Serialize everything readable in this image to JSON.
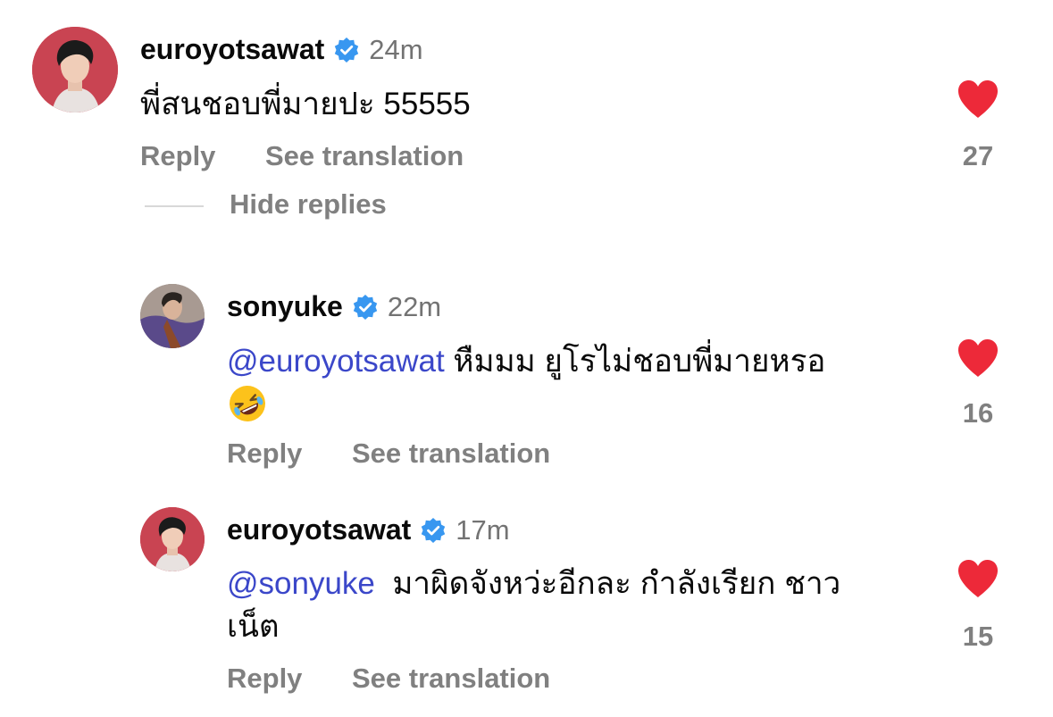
{
  "comments": [
    {
      "username": "euroyotsawat",
      "time": "24m",
      "mention": "",
      "text": "พี่สนชอบพี่มายปะ 55555",
      "text_line2": "",
      "reply_label": "Reply",
      "translate_label": "See translation",
      "likes": "27"
    },
    {
      "username": "sonyuke",
      "time": "22m",
      "mention": "@euroyotsawat",
      "text": " หืมมม ยูโรไม่ชอบพี่มายหรอ",
      "text_line2": "",
      "emoji": "rolling-on-the-floor-laughing-emoji",
      "reply_label": "Reply",
      "translate_label": "See translation",
      "likes": "16"
    },
    {
      "username": "euroyotsawat",
      "time": "17m",
      "mention": "@sonyuke",
      "text": "  มาผิดจังหว่ะอีกละ กำลังเรียก ชาว",
      "text_line2": "เน็ต",
      "reply_label": "Reply",
      "translate_label": "See translation",
      "likes": "15"
    }
  ],
  "thread": {
    "hide_replies_label": "Hide replies"
  },
  "colors": {
    "heart": "#ed2939",
    "verified": "#3897f0",
    "mention": "#3b47c9",
    "secondary_text": "#808080"
  },
  "icons": {
    "verified": "verified-badge-icon",
    "like": "heart-icon"
  }
}
